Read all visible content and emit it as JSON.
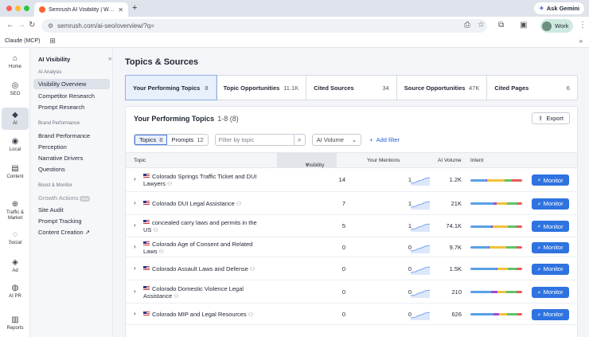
{
  "browser": {
    "tab_title": "Semrush AI Visibility | Win E...",
    "new_tab": "+",
    "ask_gemini": "Ask Gemini",
    "url_site": "semrush.com",
    "url_path": "/ai-seo/overview/?q=",
    "profile": "Work",
    "bookmark": "Claude (MCP)",
    "colors": {
      "close": "#ff5f57",
      "min": "#febc2e",
      "max": "#28c840"
    }
  },
  "rail": [
    {
      "label": "Home",
      "icon": "home-icon",
      "glyph": "⌂"
    },
    {
      "label": "SEO",
      "icon": "seo-icon",
      "glyph": "◎"
    },
    {
      "label": "AI",
      "icon": "ai-icon",
      "glyph": "◆"
    },
    {
      "label": "Local",
      "icon": "local-icon",
      "glyph": "◉"
    },
    {
      "label": "Content",
      "icon": "content-icon",
      "glyph": "▤"
    },
    {
      "label": "Traffic & Market",
      "icon": "traffic-icon",
      "glyph": "⊕"
    },
    {
      "label": "Social",
      "icon": "social-icon",
      "glyph": "◌"
    },
    {
      "label": "Ad",
      "icon": "ad-icon",
      "glyph": "◈"
    },
    {
      "label": "AI PR",
      "icon": "ai-pr-icon",
      "glyph": "◍"
    },
    {
      "label": "Reports",
      "icon": "reports-icon",
      "glyph": "▥"
    }
  ],
  "sidebar": {
    "title": "AI Visibility",
    "sections": {
      "analysis": "AI Analysis",
      "brand": "Brand Performance",
      "boost": "Boost & Monitor"
    },
    "items": {
      "visibility_overview": "Visibility Overview",
      "competitor_research": "Competitor Research",
      "prompt_research": "Prompt Research",
      "brand_performance": "Brand Performance",
      "perception": "Perception",
      "narrative_drivers": "Narrative Drivers",
      "questions": "Questions",
      "growth_actions": "Growth Actions",
      "growth_badge": "new",
      "site_audit": "Site Audit",
      "prompt_tracking": "Prompt Tracking",
      "content_creation": "Content Creation"
    }
  },
  "main": {
    "title": "Topics & Sources",
    "kpis": [
      {
        "label": "Your Performing Topics",
        "value": "8"
      },
      {
        "label": "Topic Opportunities",
        "value": "11.1K"
      },
      {
        "label": "Cited Sources",
        "value": "34"
      },
      {
        "label": "Source Opportunities",
        "value": "47K"
      },
      {
        "label": "Cited Pages",
        "value": "6"
      }
    ],
    "card": {
      "title": "Your Performing Topics",
      "count": "1-8 (8)",
      "export": "Export",
      "seg_topics": "Topics",
      "seg_topics_n": "8",
      "seg_prompts": "Prompts",
      "seg_prompts_n": "12",
      "filter_placeholder": "Filter by topic",
      "volume_select": "AI Volume",
      "add_filter": "Add filter",
      "headers": {
        "topic": "Topic",
        "visibility": "Visibility",
        "mentions": "Your Mentions",
        "volume": "AI Volume",
        "intent": "Intent"
      },
      "monitor_label": "Monitor"
    }
  },
  "rows": [
    {
      "topic": "Colorado Springs Traffic Ticket and DUI Lawyers",
      "visibility": "14",
      "mentions": "1",
      "volume": "1.2K"
    },
    {
      "topic": "Colorado DUI Legal Assistance",
      "visibility": "7",
      "mentions": "1",
      "volume": "21K"
    },
    {
      "topic": "concealed carry laws and permits in the US",
      "visibility": "5",
      "mentions": "1",
      "volume": "74.1K"
    },
    {
      "topic": "Colorado Age of Consent and Related Laws",
      "visibility": "0",
      "mentions": "0",
      "volume": "9.7K"
    },
    {
      "topic": "Colorado Assault Laws and Defense",
      "visibility": "0",
      "mentions": "0",
      "volume": "1.5K"
    },
    {
      "topic": "Colorado Domestic Violence Legal Assistance",
      "visibility": "0",
      "mentions": "0",
      "volume": "210"
    },
    {
      "topic": "Colorado MIP and Legal Resources",
      "visibility": "0",
      "mentions": "0",
      "volume": "626"
    }
  ],
  "intent_colors": {
    "informational": "#5aa0e6",
    "navigational": "#a14ad1",
    "commercial": "#f0c23a",
    "transactional": "#62c26c",
    "unknown": "#e55b5b"
  },
  "accent": "#2e73e0"
}
